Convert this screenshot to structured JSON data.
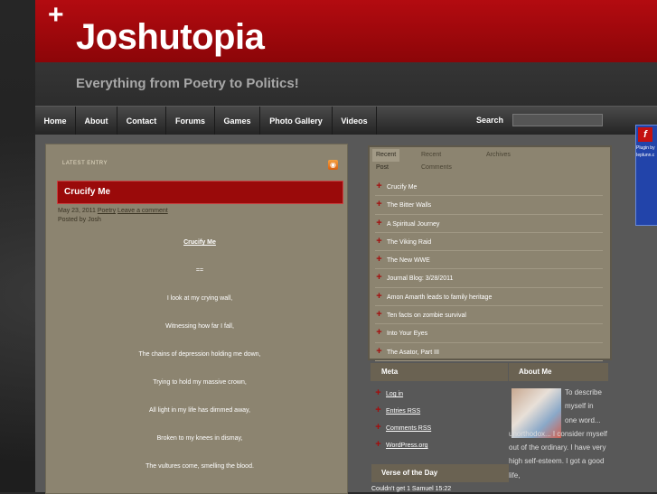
{
  "site": {
    "title": "Joshutopia",
    "tagline": "Everything from Poetry to Politics!"
  },
  "nav": {
    "items": [
      "Home",
      "About",
      "Contact",
      "Forums",
      "Games",
      "Photo Gallery",
      "Videos"
    ],
    "search_label": "Search",
    "search_value": ""
  },
  "post": {
    "section_label": "LATEST ENTRY",
    "title": "Crucify Me",
    "date": "May 23, 2011",
    "category": "Poetry",
    "comment_link": "Leave a comment",
    "posted_by": "Posted by Josh",
    "poem_title": "Crucify Me",
    "separator": "==",
    "lines": [
      "I look at my crying wall,",
      "Witnessing how far I fall,",
      "The chains of depression holding me down,",
      "Trying to hold my massive crown,",
      "All light in my life has dimmed away,",
      "Broken to my knees in dismay,",
      "The vultures come, smelling the blood."
    ]
  },
  "sidebar": {
    "tabs": [
      "Recent Post",
      "Recent Comments",
      "Archives"
    ],
    "recent_posts": [
      "Crucify Me",
      "The Bitter Walls",
      "A Spiritual Journey",
      "The Viking Raid",
      "The New WWE",
      "Journal Blog: 3/28/2011",
      "Amon Amarth leads to family heritage",
      "Ten facts on zombie survival",
      "Into Your Eyes",
      "The Asator, Part III"
    ],
    "meta": {
      "heading": "Meta",
      "links": [
        "Log in",
        "Entries RSS",
        "Comments RSS",
        "WordPress.org"
      ]
    },
    "about": {
      "heading": "About Me",
      "text_lines": [
        "To describe",
        "myself in",
        "one word..."
      ],
      "text_rest": "unorthodox... I consider myself out of the ordinary. I have very high self-esteem. I got a good life,"
    },
    "votd": {
      "heading": "Verse of the Day",
      "text": "Couldn't get 1 Samuel 15:22"
    }
  },
  "plugin": {
    "icon_glyph": "f",
    "text": "Plugin by Ieplunn.c"
  },
  "colors": {
    "header_red": "#b30b10",
    "accent_red": "#a30d0d",
    "panel_tan": "#8c8470"
  }
}
